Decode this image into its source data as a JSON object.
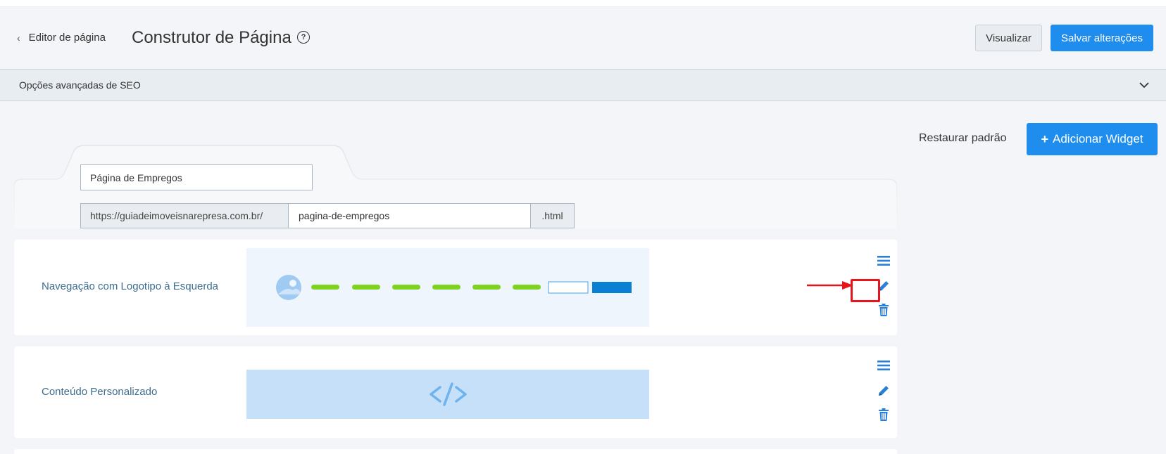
{
  "header": {
    "back_label": "Editor de página",
    "title": "Construtor de Página",
    "help_icon": "question-circle-icon",
    "preview_label": "Visualizar",
    "save_label": "Salvar alterações"
  },
  "seo": {
    "label": "Opções avançadas de SEO"
  },
  "actions": {
    "restore_label": "Restaurar padrão",
    "add_widget_label": "Adicionar Widget",
    "add_widget_icon": "+"
  },
  "page": {
    "title_value": "Página de Empregos",
    "url_prefix": "https://guiadeimoveisnarepresa.com.br/",
    "slug_value": "pagina-de-empregos",
    "url_suffix": ".html"
  },
  "widgets": [
    {
      "label": "Navegação com Logotipo à Esquerda",
      "preview": "nav-logo-left"
    },
    {
      "label": "Conteúdo Personalizado",
      "preview": "custom-code"
    }
  ],
  "colors": {
    "primary": "#1f8ded",
    "nav_dash": "#7ed321",
    "highlight": "#e8141c",
    "icon_blue": "#2b7fd6"
  }
}
